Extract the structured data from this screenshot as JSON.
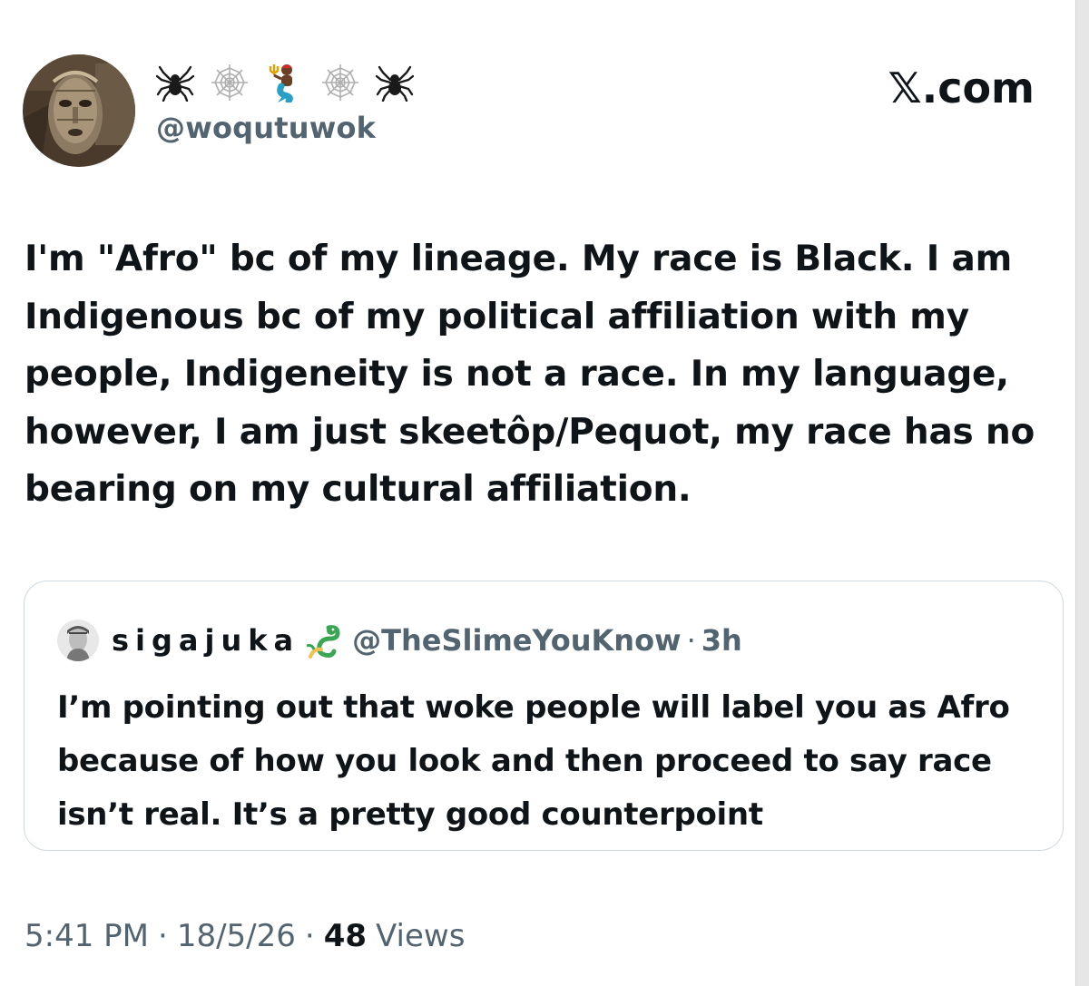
{
  "author": {
    "display_name_icons": [
      "spider-icon",
      "spider-web-icon",
      "merman-icon",
      "spider-web-icon",
      "spider-icon"
    ],
    "handle": "@woqutuwok",
    "avatar": "mask-avatar"
  },
  "brand": {
    "label": "𝕏.com"
  },
  "tweet": {
    "text": "I'm \"Afro\" bc of my lineage. My race is Black. I am Indigenous bc of my political affiliation with my people, Indigeneity is not a race. In my language, however, I am just skeetôp/Pequot, my race has no bearing on my cultural affiliation."
  },
  "quote": {
    "name": "sigajuka",
    "name_icon": "dragon-icon",
    "handle": "@TheSlimeYouKnow",
    "separator": "·",
    "time": "3h",
    "text": "I’m pointing out that woke people will label you as Afro because of how you look and then proceed to say race isn’t real. It’s a pretty good counterpoint"
  },
  "footer": {
    "time": "5:41 PM",
    "separator": "·",
    "date": "18/5/26",
    "views_count": "48",
    "views_label": "Views"
  },
  "colors": {
    "text": "#0f1419",
    "secondary": "#536471",
    "border": "#cfd9de"
  }
}
